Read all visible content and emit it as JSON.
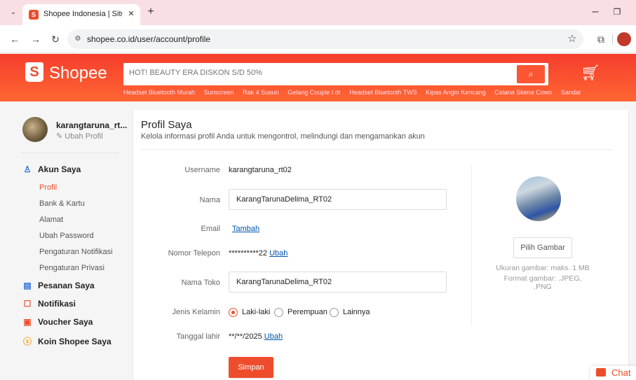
{
  "browser": {
    "tab_title": "Shopee Indonesia | Situs Belanja",
    "tab_close": "✕",
    "new_tab": "+",
    "url": "shopee.co.id/user/account/profile",
    "icons": [
      "tab-dropdown-icon",
      "back-icon",
      "forward-icon",
      "reload-icon",
      "site-info-icon",
      "bookmark-star-icon",
      "extensions-icon",
      "profile-icon",
      "minimize-icon",
      "restore-icon"
    ]
  },
  "header": {
    "logo": "Shopee",
    "search_placeholder": "HOT! BEAUTY ERA DISKON S/D 50%",
    "suggestions": [
      "Headset Bluetooth Murah",
      "Sunscreen",
      "Rak 4 Susun",
      "Gelang Couple I dr",
      "Headset Bluetooth TWS",
      "Kipas Angin Kencang",
      "Celana Skena Cowo",
      "Sandal"
    ],
    "accent": "#ee4d2d"
  },
  "sidebar": {
    "username": "karangtaruna_rt...",
    "edit_label": "Ubah Profil",
    "account": {
      "label": "Akun Saya",
      "items": [
        "Profil",
        "Bank & Kartu",
        "Alamat",
        "Ubah Password",
        "Pengaturan Notifikasi",
        "Pengaturan Privasi"
      ],
      "active": "Profil"
    },
    "sections": [
      "Pesanan Saya",
      "Notifikasi",
      "Voucher Saya",
      "Koin Shopee Saya"
    ]
  },
  "profile": {
    "title": "Profil Saya",
    "subtitle": "Kelola informasi profil Anda untuk mengontrol, melindungi dan mengamankan akun",
    "username_label": "Username",
    "username_value": "karangtaruna_rt02",
    "name_label": "Nama",
    "name_value": "KarangTarunaDelima_RT02",
    "email_label": "Email",
    "email_action": "Tambah",
    "phone_label": "Nomor Telepon",
    "phone_value": "**********22",
    "phone_action": "Ubah",
    "shop_label": "Nama Toko",
    "shop_value": "KarangTarunaDelima_RT02",
    "gender_label": "Jenis Kelamin",
    "gender_options": [
      "Laki-laki",
      "Perempuan",
      "Lainnya"
    ],
    "gender_selected": "Laki-laki",
    "dob_label": "Tanggal lahir",
    "dob_value": "**/**/2025",
    "dob_action": "Ubah",
    "save_label": "Simpan",
    "pick_image_label": "Pilih Gambar",
    "image_size_note": "Ukuran gambar: maks. 1 MB",
    "image_format_note": "Format gambar: .JPEG, .PNG"
  },
  "chat_label": "Chat"
}
